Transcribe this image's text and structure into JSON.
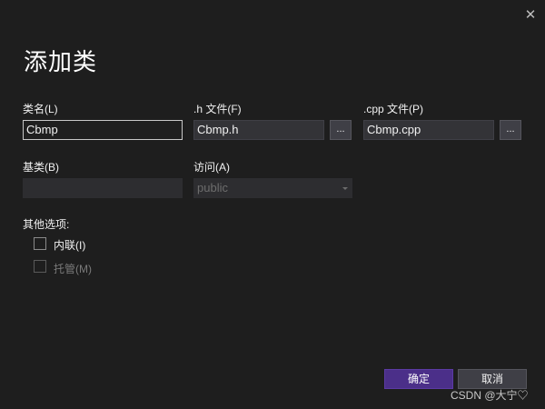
{
  "dialog": {
    "title": "添加类",
    "close_glyph": "✕"
  },
  "fields": {
    "class_name": {
      "label": "类名(L)",
      "value": "Cbmp"
    },
    "h_file": {
      "label": ".h 文件(F)",
      "value": "Cbmp.h",
      "browse": "..."
    },
    "cpp_file": {
      "label": ".cpp 文件(P)",
      "value": "Cbmp.cpp",
      "browse": "..."
    },
    "base_class": {
      "label": "基类(B)",
      "value": ""
    },
    "access": {
      "label": "访问(A)",
      "value": "public"
    }
  },
  "options": {
    "label": "其他选项:",
    "inline": {
      "label": "内联(I)",
      "checked": false,
      "enabled": true
    },
    "managed": {
      "label": "托管(M)",
      "checked": false,
      "enabled": false
    }
  },
  "buttons": {
    "ok": "确定",
    "cancel": "取消"
  },
  "watermark": "CSDN @大宁♡",
  "colors": {
    "background": "#1e1e1e",
    "primary_button": "#4b2f89",
    "input_bg": "#333337"
  }
}
